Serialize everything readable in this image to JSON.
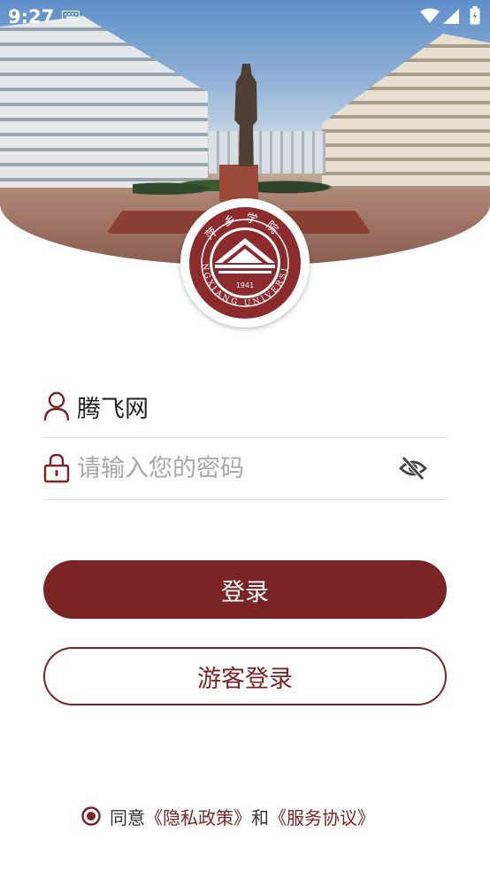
{
  "status_bar": {
    "time": "9:27",
    "icons": [
      "keyboard-icon",
      "wifi-icon",
      "signal-icon",
      "battery-icon"
    ]
  },
  "logo": {
    "name": "pingxiang-university-emblem",
    "founded": "1941",
    "ring_text": "PINGXIANG UNIVERSITY",
    "ring_text_cn": "萍乡学院"
  },
  "form": {
    "username": {
      "value": "腾飞网",
      "icon": "user-icon"
    },
    "password": {
      "value": "",
      "placeholder": "请输入您的密码",
      "icon": "lock-icon",
      "toggle_icon": "eye-off-icon"
    }
  },
  "buttons": {
    "login_label": "登录",
    "guest_label": "游客登录"
  },
  "agreement": {
    "prefix": "同意",
    "privacy_link": "《隐私政策》",
    "conjunction": "和",
    "service_link": "《服务协议》",
    "checked": true
  },
  "colors": {
    "accent": "#7b2426",
    "placeholder": "#a7a7a7",
    "divider": "#e2e2e2"
  }
}
